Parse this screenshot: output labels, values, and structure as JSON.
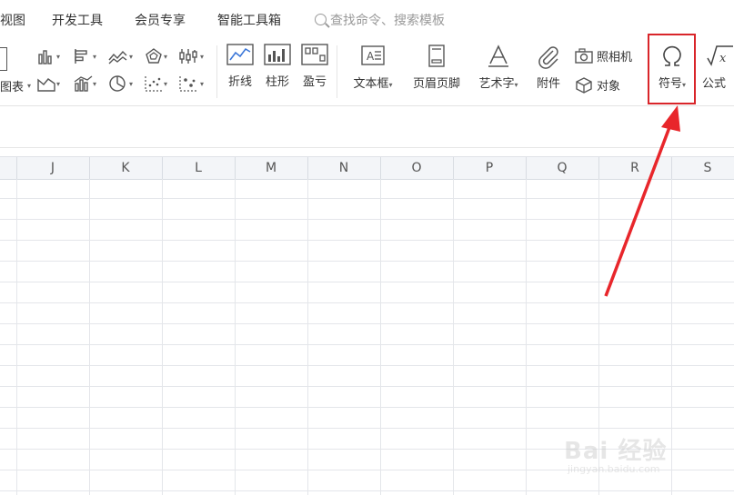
{
  "menu": {
    "items": [
      "视图",
      "开发工具",
      "会员专享",
      "智能工具箱"
    ],
    "search_placeholder": "查找命令、搜索模板"
  },
  "ribbon": {
    "chart_label": "图表",
    "sparklines": [
      "折线",
      "柱形",
      "盈亏"
    ],
    "textbox": "文本框",
    "header_footer": "页眉页脚",
    "wordart": "艺术字",
    "attachment": "附件",
    "camera": "照相机",
    "object": "对象",
    "symbol": "符号",
    "formula": "公式"
  },
  "columns": [
    "J",
    "K",
    "L",
    "M",
    "N",
    "O",
    "P",
    "Q",
    "R",
    "S"
  ],
  "watermark": {
    "text": "Bai 经验",
    "url": "jingyan.baidu.com"
  },
  "colors": {
    "highlight": "#d9252a",
    "arrow": "#e8262b"
  }
}
